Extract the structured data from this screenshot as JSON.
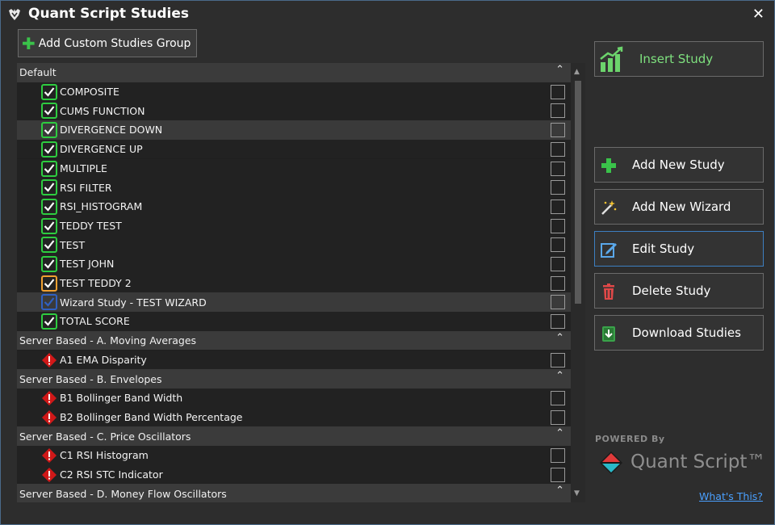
{
  "window": {
    "title": "Quant Script Studies"
  },
  "toolbar": {
    "add_group_label": "Add Custom Studies Group"
  },
  "rows": [
    {
      "kind": "group",
      "label": "Default"
    },
    {
      "kind": "item",
      "label": "COMPOSITE",
      "status": "ok"
    },
    {
      "kind": "item",
      "label": "CUMS FUNCTION",
      "status": "ok"
    },
    {
      "kind": "item",
      "label": "DIVERGENCE DOWN",
      "status": "ok",
      "highlight": true
    },
    {
      "kind": "item",
      "label": "DIVERGENCE UP",
      "status": "ok"
    },
    {
      "kind": "item",
      "label": "MULTIPLE",
      "status": "ok"
    },
    {
      "kind": "item",
      "label": "RSI FILTER",
      "status": "ok"
    },
    {
      "kind": "item",
      "label": "RSI_HISTOGRAM",
      "status": "ok"
    },
    {
      "kind": "item",
      "label": "TEDDY TEST",
      "status": "ok"
    },
    {
      "kind": "item",
      "label": "TEST",
      "status": "ok"
    },
    {
      "kind": "item",
      "label": "TEST JOHN",
      "status": "ok"
    },
    {
      "kind": "item",
      "label": "TEST TEDDY 2",
      "status": "warn"
    },
    {
      "kind": "item",
      "label": "Wizard Study - TEST WIZARD",
      "status": "wizard",
      "highlight": true
    },
    {
      "kind": "item",
      "label": "TOTAL SCORE",
      "status": "ok"
    },
    {
      "kind": "group",
      "label": "Server Based - A. Moving Averages"
    },
    {
      "kind": "item",
      "label": "A1 EMA Disparity",
      "status": "error"
    },
    {
      "kind": "group",
      "label": "Server Based - B. Envelopes"
    },
    {
      "kind": "item",
      "label": "B1 Bollinger Band Width",
      "status": "error"
    },
    {
      "kind": "item",
      "label": "B2 Bollinger Band Width Percentage",
      "status": "error"
    },
    {
      "kind": "group",
      "label": "Server Based - C. Price Oscillators"
    },
    {
      "kind": "item",
      "label": "C1 RSI Histogram",
      "status": "error"
    },
    {
      "kind": "item",
      "label": "C2 RSI STC Indicator",
      "status": "error"
    },
    {
      "kind": "group",
      "label": "Server Based - D. Money Flow Oscillators"
    }
  ],
  "actions": {
    "insert": "Insert Study",
    "add_new": "Add New Study",
    "add_wizard": "Add New Wizard",
    "edit": "Edit Study",
    "delete": "Delete Study",
    "download": "Download Studies"
  },
  "branding": {
    "powered": "POWERED By",
    "brand": "Quant Script™",
    "whats_this": "What's This?"
  },
  "colors": {
    "ok": "#2ecc40",
    "warn": "#f0a030",
    "wizard": "#3060c0",
    "error": "#d01818",
    "accent": "#3d7fc1"
  }
}
